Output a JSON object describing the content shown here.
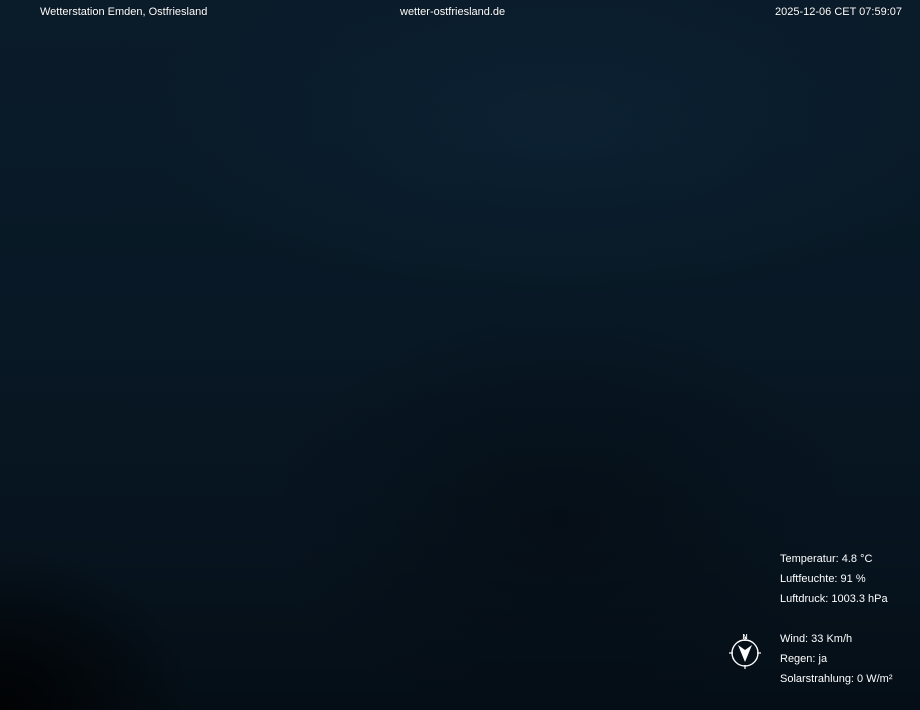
{
  "header": {
    "station": "Wetterstation Emden, Ostfriesland",
    "site": "wetter-ostfriesland.de",
    "timestamp": "2025-12-06 CET 07:59:07"
  },
  "readings": {
    "temperature": "Temperatur: 4.8 °C",
    "humidity": "Luftfeuchte: 91 %",
    "pressure": "Luftdruck: 1003.3 hPa",
    "wind": "Wind: 33 Km/h",
    "rain": "Regen: ja",
    "solar": "Solarstrahlung: 0 W/m²"
  },
  "compass": {
    "north_label": "N",
    "icon": "wind-direction-compass-icon",
    "arrow_color": "#ffffff"
  }
}
